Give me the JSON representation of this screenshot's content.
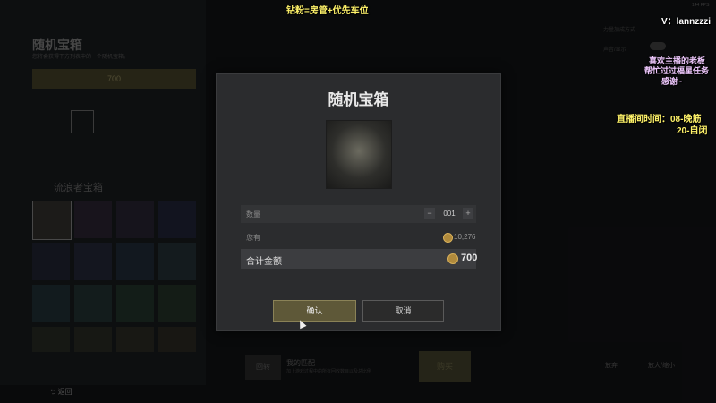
{
  "background": {
    "title": "随机宝箱",
    "subtitle": "您将会获得下方列表中的一个随机宝箱。",
    "price": "700",
    "section_title": "流浪者宝箱",
    "back_label": "返回",
    "fps": "144 FPS",
    "right_panel_label_1": "力量加成方式",
    "right_panel_label_2": "声音/显示",
    "bottom_button_left": "回转",
    "bottom_title": "我的匹配",
    "bottom_desc": "加上游戏过程中的所有回收数目以及总比例",
    "bottom_button_right": "购买",
    "bottom_right_1": "放弃",
    "bottom_right_2": "放大/缩小"
  },
  "dialog": {
    "title": "随机宝箱",
    "quantity_label": "数量",
    "quantity_value": "001",
    "owned_label": "您有",
    "owned_value": "10,276",
    "total_label": "合计金额",
    "total_value": "700",
    "confirm_label": "确认",
    "cancel_label": "取消"
  },
  "overlay": {
    "top_text": "钻粉=房管+优先车位",
    "v_text": "V：lannzzzi",
    "thanks_1": "喜欢主播的老板",
    "thanks_2": "帮忙过过福星任务",
    "thanks_3": "感谢~",
    "live_time_1": "直播间时间：08-晚筋",
    "live_time_2": "20-自闭"
  },
  "colors": {
    "accent_gold": "#5e5838",
    "coin": "#b08a3c",
    "overlay_yellow": "#fff36a",
    "overlay_pink": "#f0c9ff"
  }
}
